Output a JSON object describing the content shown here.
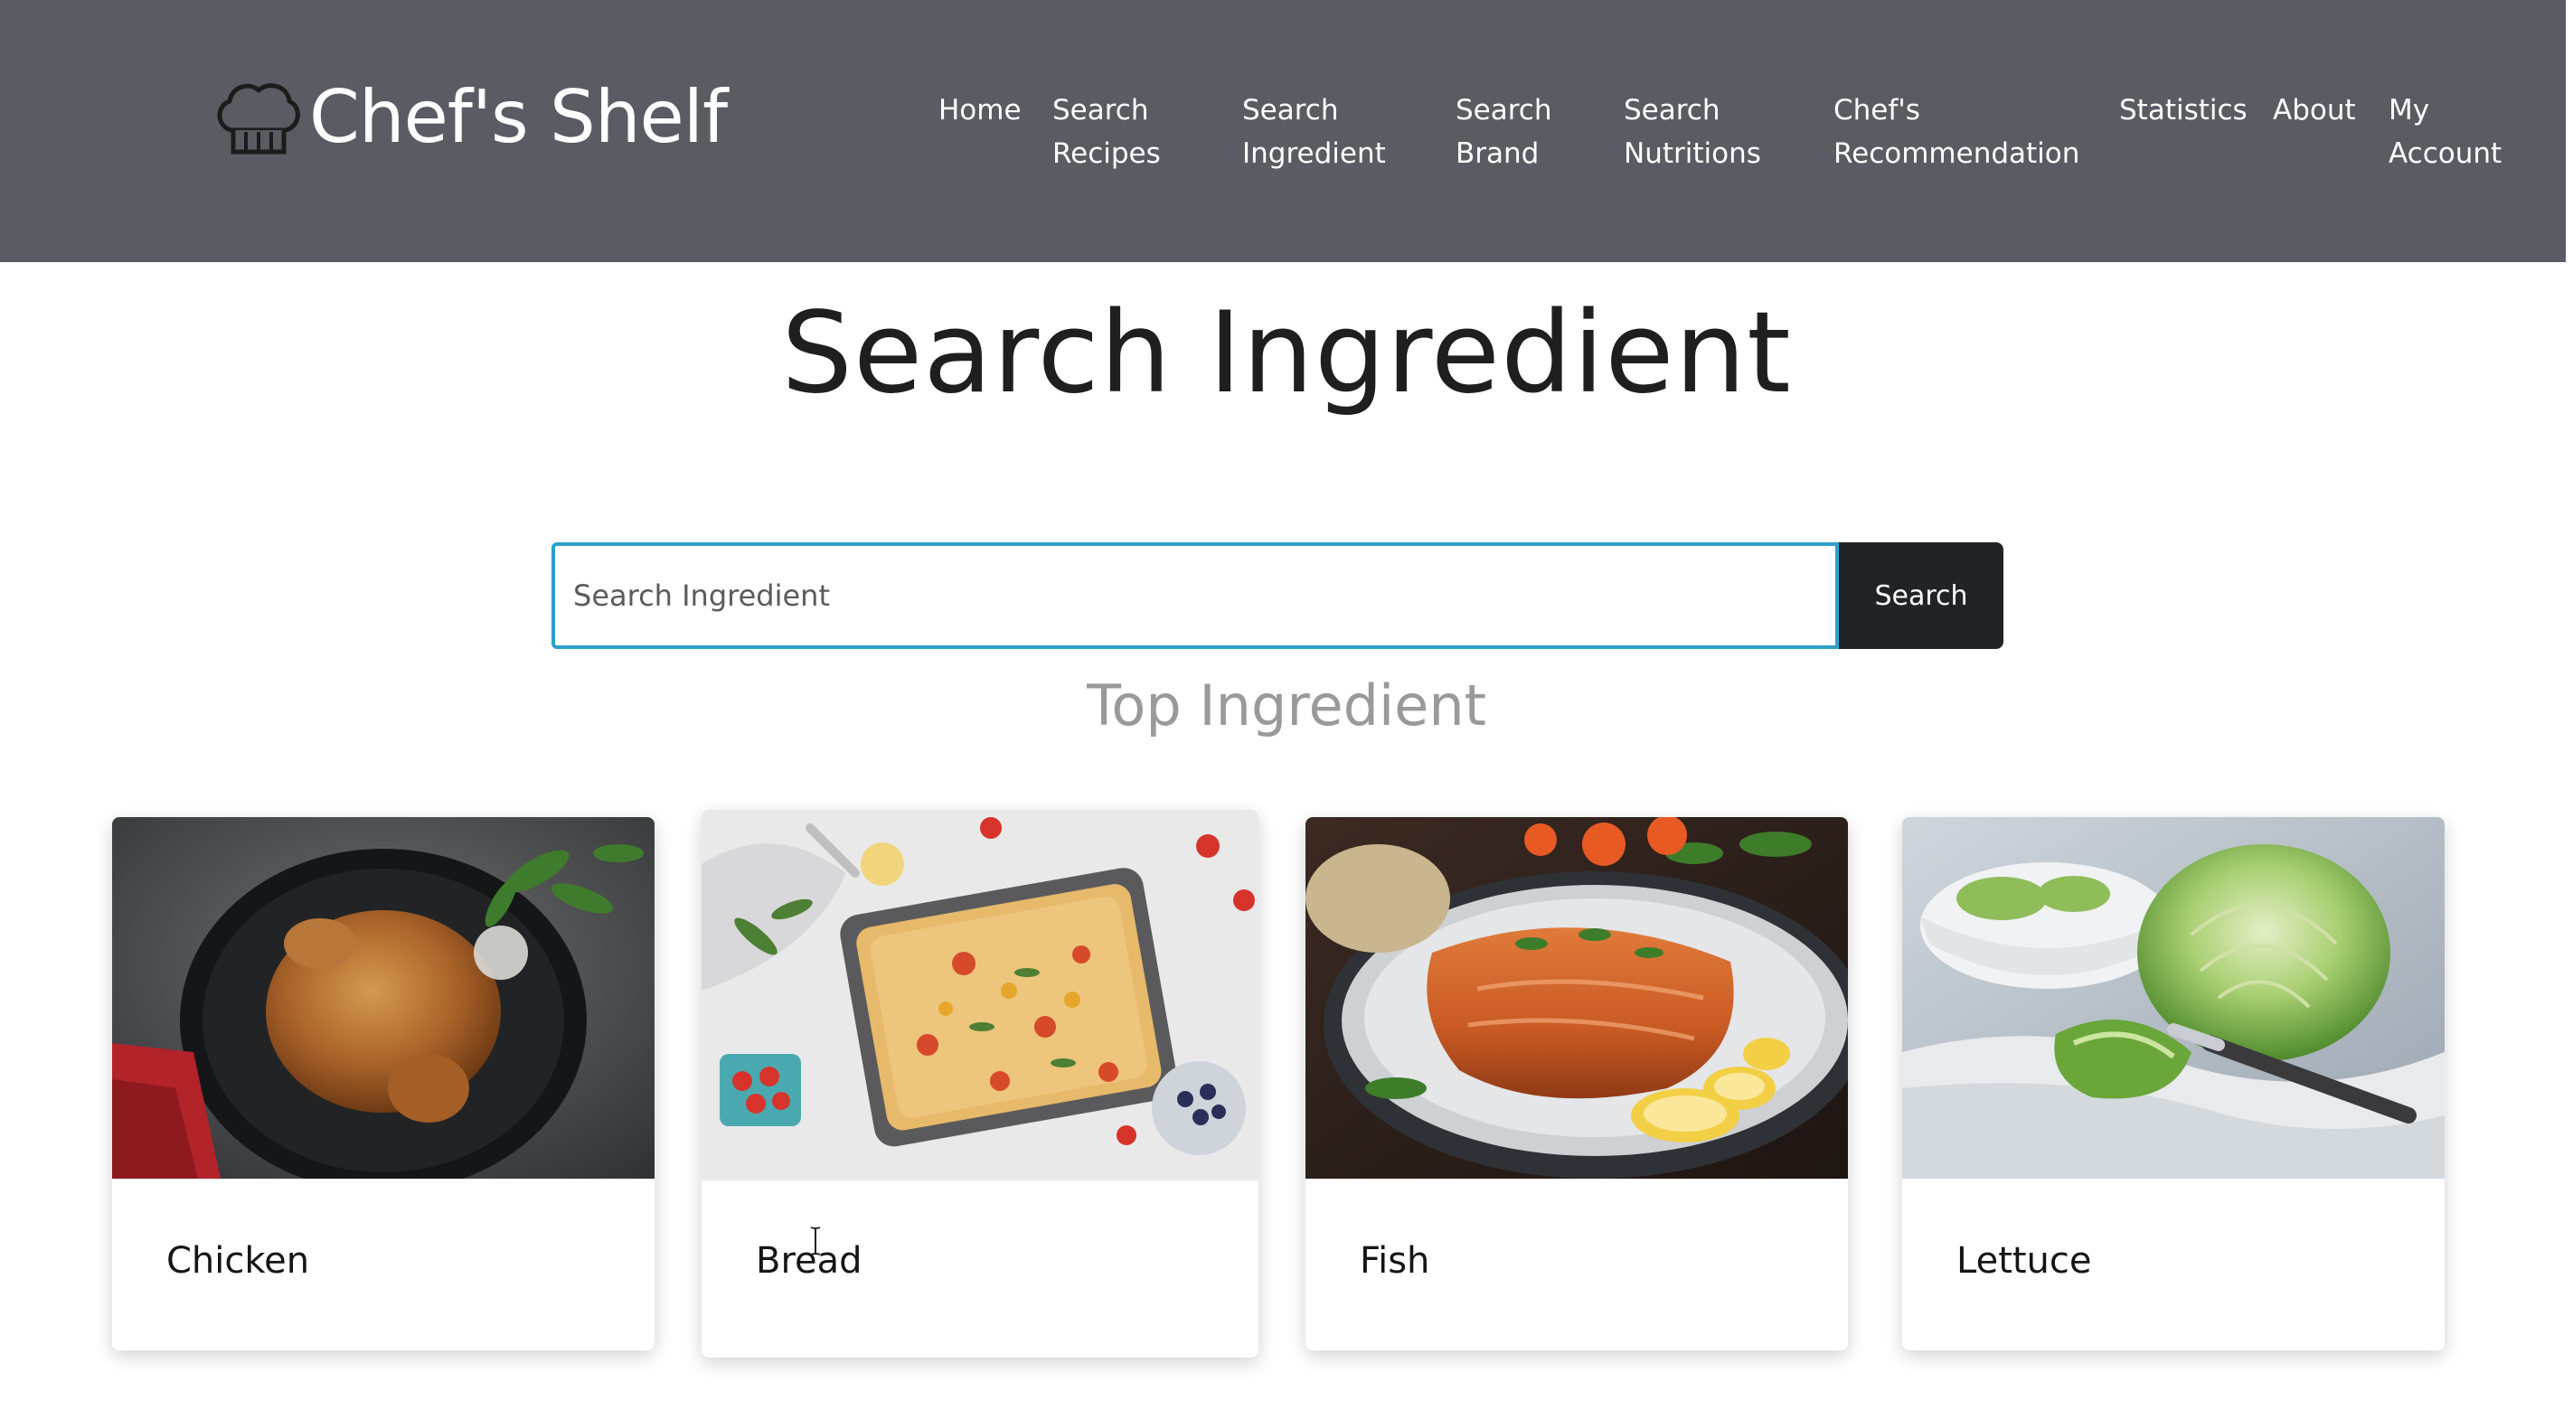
{
  "header": {
    "brand": "Chef's Shelf",
    "nav": [
      {
        "label": "Home"
      },
      {
        "label": "Search\nRecipes"
      },
      {
        "label": "Search\nIngredient"
      },
      {
        "label": "Search\nBrand"
      },
      {
        "label": "Search\nNutritions"
      },
      {
        "label": "Chef's\nRecommendation"
      },
      {
        "label": "Statistics"
      },
      {
        "label": "About"
      },
      {
        "label": "My\nAccount"
      }
    ]
  },
  "main": {
    "title": "Search Ingredient",
    "search": {
      "placeholder": "Search Ingredient",
      "value": "",
      "button": "Search"
    },
    "section_title": "Top Ingredient",
    "cards": [
      {
        "label": "Chicken",
        "image": "roast-chicken-image"
      },
      {
        "label": "Bread",
        "image": "focaccia-bread-image"
      },
      {
        "label": "Fish",
        "image": "salmon-fillet-image"
      },
      {
        "label": "Lettuce",
        "image": "lettuce-image"
      }
    ]
  },
  "colors": {
    "header_bg": "#595c63",
    "search_border": "#2f9fca",
    "button_bg": "#222326"
  }
}
